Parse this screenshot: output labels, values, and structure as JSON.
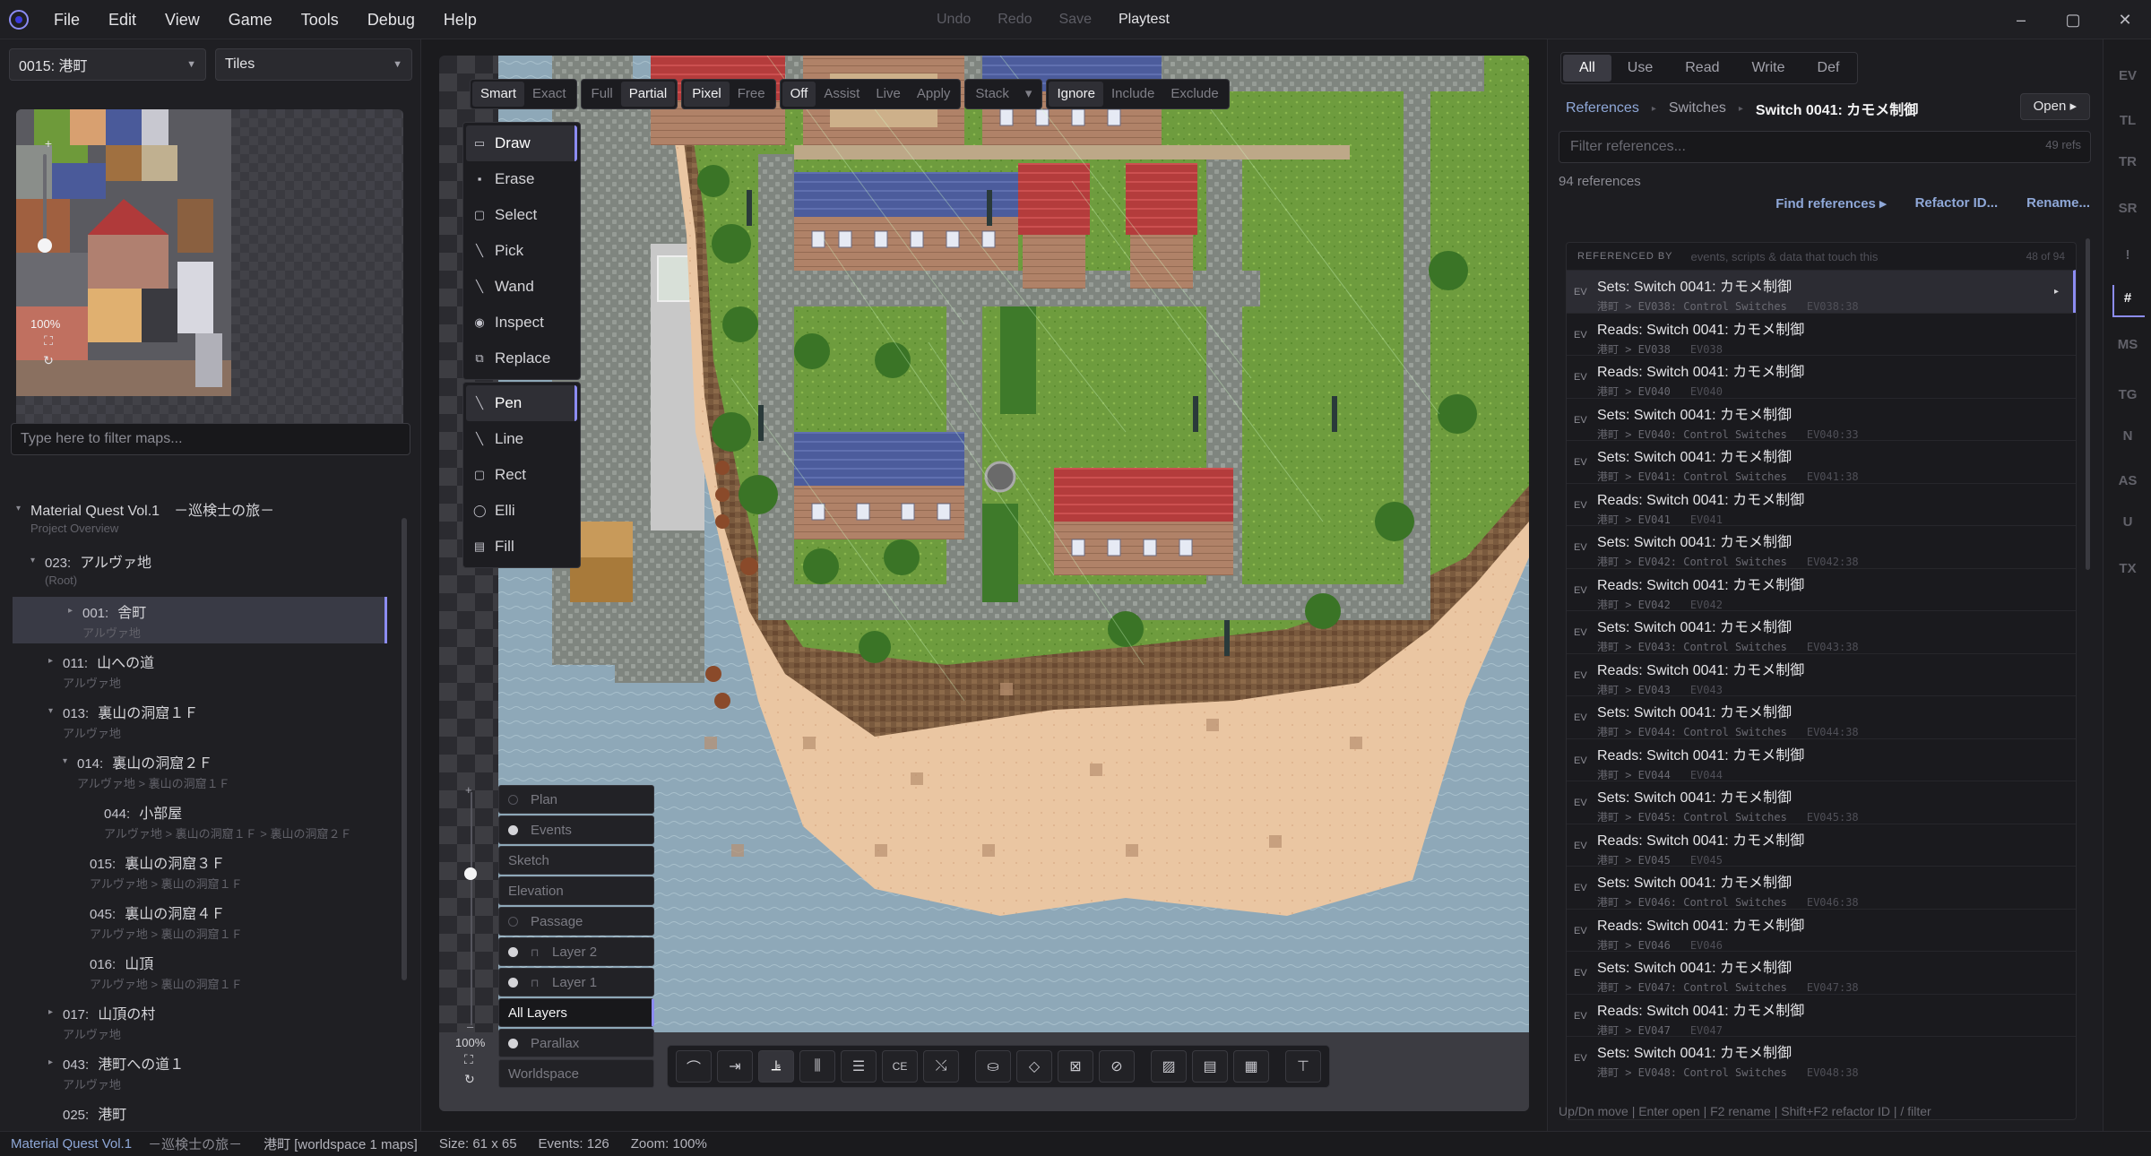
{
  "menubar": {
    "items": [
      "File",
      "Edit",
      "View",
      "Game",
      "Tools",
      "Debug",
      "Help"
    ],
    "actions": [
      "Undo",
      "Redo",
      "Save",
      "Playtest"
    ],
    "window_controls": [
      "–",
      "▢",
      "✕"
    ]
  },
  "left": {
    "map_select": "0015: 港町",
    "layer_select": "Tiles",
    "zoom": "100%",
    "filter_placeholder": "Type here to filter maps...",
    "tree": [
      {
        "num": "",
        "title": "Material Quest Vol.1　－巡検士の旅－",
        "sub": "Project Overview",
        "depth": 0,
        "twisty": "▾"
      },
      {
        "num": "023:",
        "title": "アルヴァ地",
        "sub": "(Root)",
        "depth": 1,
        "twisty": "▾"
      },
      {
        "num": "001:",
        "title": "舎町",
        "sub": "アルヴァ地",
        "depth": 2,
        "twisty": "▸"
      },
      {
        "num": "011:",
        "title": "山への道",
        "sub": "アルヴァ地",
        "depth": 2,
        "twisty": "▸"
      },
      {
        "num": "013:",
        "title": "裏山の洞窟１Ｆ",
        "sub": "アルヴァ地",
        "depth": 2,
        "twisty": "▾"
      },
      {
        "num": "014:",
        "title": "裏山の洞窟２Ｆ",
        "sub": "アルヴァ地 > 裏山の洞窟１Ｆ",
        "depth": 3,
        "twisty": "▾"
      },
      {
        "num": "044:",
        "title": "小部屋",
        "sub": "アルヴァ地 > 裏山の洞窟１Ｆ > 裏山の洞窟２Ｆ",
        "depth": 4,
        "twisty": ""
      },
      {
        "num": "015:",
        "title": "裏山の洞窟３Ｆ",
        "sub": "アルヴァ地 > 裏山の洞窟１Ｆ",
        "depth": 3,
        "twisty": ""
      },
      {
        "num": "045:",
        "title": "裏山の洞窟４Ｆ",
        "sub": "アルヴァ地 > 裏山の洞窟１Ｆ",
        "depth": 3,
        "twisty": ""
      },
      {
        "num": "016:",
        "title": "山頂",
        "sub": "アルヴァ地 > 裏山の洞窟１Ｆ",
        "depth": 3,
        "twisty": ""
      },
      {
        "num": "017:",
        "title": "山頂の村",
        "sub": "アルヴァ地",
        "depth": 2,
        "twisty": "▸"
      },
      {
        "num": "043:",
        "title": "港町への道１",
        "sub": "アルヴァ地",
        "depth": 2,
        "twisty": "▸"
      },
      {
        "num": "025:",
        "title": "港町",
        "sub": "",
        "depth": 2,
        "twisty": ""
      }
    ]
  },
  "canvas": {
    "modes": [
      [
        "Smart",
        "Exact"
      ],
      [
        "Full",
        "Partial"
      ],
      [
        "Pixel",
        "Free"
      ],
      [
        "Off",
        "Assist",
        "Live",
        "Apply"
      ],
      [
        "Stack",
        "▾"
      ],
      [
        "Ignore",
        "Include",
        "Exclude"
      ]
    ],
    "select_tools": [
      "Draw",
      "Erase",
      "Select",
      "Pick",
      "Wand",
      "Inspect",
      "Replace"
    ],
    "shape_tools": [
      "Pen",
      "Line",
      "Rect",
      "Elli",
      "Fill"
    ],
    "layers": [
      "Plan",
      "Events",
      "Sketch",
      "Elevation",
      "Passage",
      "Layer 2",
      "Layer 1",
      "All Layers",
      "Parallax",
      "Worldspace"
    ],
    "zoom": "100%",
    "bottom_tools": [
      "⌒",
      "⇥",
      "⫡",
      "⫼",
      "☰",
      "CE",
      "⤯",
      "⛀",
      "◇",
      "⊠",
      "⊘",
      "▨",
      "▤",
      "▦",
      "⊤"
    ]
  },
  "references": {
    "tabs": [
      "All",
      "Use",
      "Read",
      "Write",
      "Def"
    ],
    "breadcrumb": [
      "References",
      "Switches",
      "Switch 0041: カモメ制御"
    ],
    "open_label": "Open ▸",
    "filter_placeholder": "Filter references...",
    "filter_count": "49 refs",
    "total": "94 references",
    "actions": [
      "Find references ▸",
      "Refactor ID...",
      "Rename..."
    ],
    "list_header": "REFERENCED BY",
    "list_desc": "events, scripts & data that touch this",
    "list_count": "48 of 94",
    "rows": [
      {
        "tag": "EV",
        "text": "Sets: Switch 0041: カモメ制御",
        "path": "港町 > EV038: Control Switches",
        "line": "EV038:38"
      },
      {
        "tag": "EV",
        "text": "Reads: Switch 0041: カモメ制御",
        "path": "港町 > EV038",
        "line": "EV038"
      },
      {
        "tag": "EV",
        "text": "Reads: Switch 0041: カモメ制御",
        "path": "港町 > EV040",
        "line": "EV040"
      },
      {
        "tag": "EV",
        "text": "Sets: Switch 0041: カモメ制御",
        "path": "港町 > EV040: Control Switches",
        "line": "EV040:33"
      },
      {
        "tag": "EV",
        "text": "Sets: Switch 0041: カモメ制御",
        "path": "港町 > EV041: Control Switches",
        "line": "EV041:38"
      },
      {
        "tag": "EV",
        "text": "Reads: Switch 0041: カモメ制御",
        "path": "港町 > EV041",
        "line": "EV041"
      },
      {
        "tag": "EV",
        "text": "Sets: Switch 0041: カモメ制御",
        "path": "港町 > EV042: Control Switches",
        "line": "EV042:38"
      },
      {
        "tag": "EV",
        "text": "Reads: Switch 0041: カモメ制御",
        "path": "港町 > EV042",
        "line": "EV042"
      },
      {
        "tag": "EV",
        "text": "Sets: Switch 0041: カモメ制御",
        "path": "港町 > EV043: Control Switches",
        "line": "EV043:38"
      },
      {
        "tag": "EV",
        "text": "Reads: Switch 0041: カモメ制御",
        "path": "港町 > EV043",
        "line": "EV043"
      },
      {
        "tag": "EV",
        "text": "Sets: Switch 0041: カモメ制御",
        "path": "港町 > EV044: Control Switches",
        "line": "EV044:38"
      },
      {
        "tag": "EV",
        "text": "Reads: Switch 0041: カモメ制御",
        "path": "港町 > EV044",
        "line": "EV044"
      },
      {
        "tag": "EV",
        "text": "Sets: Switch 0041: カモメ制御",
        "path": "港町 > EV045: Control Switches",
        "line": "EV045:38"
      },
      {
        "tag": "EV",
        "text": "Reads: Switch 0041: カモメ制御",
        "path": "港町 > EV045",
        "line": "EV045"
      },
      {
        "tag": "EV",
        "text": "Sets: Switch 0041: カモメ制御",
        "path": "港町 > EV046: Control Switches",
        "line": "EV046:38"
      },
      {
        "tag": "EV",
        "text": "Reads: Switch 0041: カモメ制御",
        "path": "港町 > EV046",
        "line": "EV046"
      },
      {
        "tag": "EV",
        "text": "Sets: Switch 0041: カモメ制御",
        "path": "港町 > EV047: Control Switches",
        "line": "EV047:38"
      },
      {
        "tag": "EV",
        "text": "Reads: Switch 0041: カモメ制御",
        "path": "港町 > EV047",
        "line": "EV047"
      },
      {
        "tag": "EV",
        "text": "Sets: Switch 0041: カモメ制御",
        "path": "港町 > EV048: Control Switches",
        "line": "EV048:38"
      }
    ],
    "help": "Up/Dn move | Enter open | F2 rename | Shift+F2 refactor ID | / filter"
  },
  "strip": [
    "EV",
    "TL",
    "TR",
    "SR",
    "!",
    "#",
    "MS",
    "TG",
    "N",
    "AS",
    "U",
    "TX"
  ],
  "status": {
    "project": "Material Quest Vol.1",
    "subtitle": "－巡検士の旅－",
    "map": "港町 [worldspace 1 maps]",
    "size": "Size: 61 x 65",
    "events": "Events: 126",
    "zoom": "Zoom: 100%"
  },
  "colors": {
    "accent": "#8c8cf2",
    "link": "#8fa8d8",
    "water": "#8fa9b8",
    "grass": "#6a9a3a",
    "sand": "#e8c4a0",
    "roof_blue": "#4a5a9a",
    "roof_red": "#b03a3a",
    "road": "#8a8e8a"
  }
}
